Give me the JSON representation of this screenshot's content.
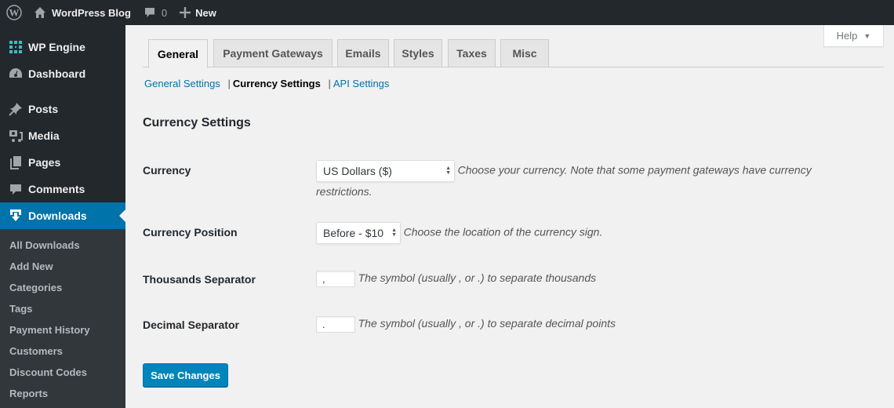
{
  "admin_bar": {
    "site_name": "WordPress Blog",
    "comments_count": "0",
    "new_label": "New"
  },
  "sidebar": {
    "items": [
      {
        "label": "WP Engine",
        "icon": "wp-engine-icon"
      },
      {
        "label": "Dashboard",
        "icon": "dashboard-icon"
      },
      {
        "label": "Posts",
        "icon": "pin-icon"
      },
      {
        "label": "Media",
        "icon": "media-icon"
      },
      {
        "label": "Pages",
        "icon": "pages-icon"
      },
      {
        "label": "Comments",
        "icon": "comment-icon"
      },
      {
        "label": "Downloads",
        "icon": "download-icon",
        "current": true
      }
    ],
    "submenu": [
      "All Downloads",
      "Add New",
      "Categories",
      "Tags",
      "Payment History",
      "Customers",
      "Discount Codes",
      "Reports"
    ]
  },
  "help": {
    "label": "Help"
  },
  "tabs": [
    {
      "label": "General",
      "active": true
    },
    {
      "label": "Payment Gateways"
    },
    {
      "label": "Emails"
    },
    {
      "label": "Styles"
    },
    {
      "label": "Taxes"
    },
    {
      "label": "Misc"
    }
  ],
  "subnav": {
    "items": [
      {
        "label": "General Settings"
      },
      {
        "label": "Currency Settings",
        "current": true
      },
      {
        "label": "API Settings"
      }
    ],
    "separator": "|"
  },
  "section_title": "Currency Settings",
  "fields": {
    "currency": {
      "label": "Currency",
      "value": "US Dollars ($)",
      "description": "Choose your currency. Note that some payment gateways have currency restrictions."
    },
    "currency_position": {
      "label": "Currency Position",
      "value": "Before - $10",
      "description": "Choose the location of the currency sign."
    },
    "thousands_separator": {
      "label": "Thousands Separator",
      "value": ",",
      "description": "The symbol (usually , or .) to separate thousands"
    },
    "decimal_separator": {
      "label": "Decimal Separator",
      "value": ".",
      "description": "The symbol (usually , or .) to separate decimal points"
    }
  },
  "save_button": {
    "label": "Save Changes"
  },
  "colors": {
    "admin_bar_bg": "#23282d",
    "sidebar_bg": "#23282d",
    "submenu_bg": "#32373c",
    "accent": "#0073aa",
    "primary_button": "#0085ba",
    "page_bg": "#f1f1f1"
  }
}
